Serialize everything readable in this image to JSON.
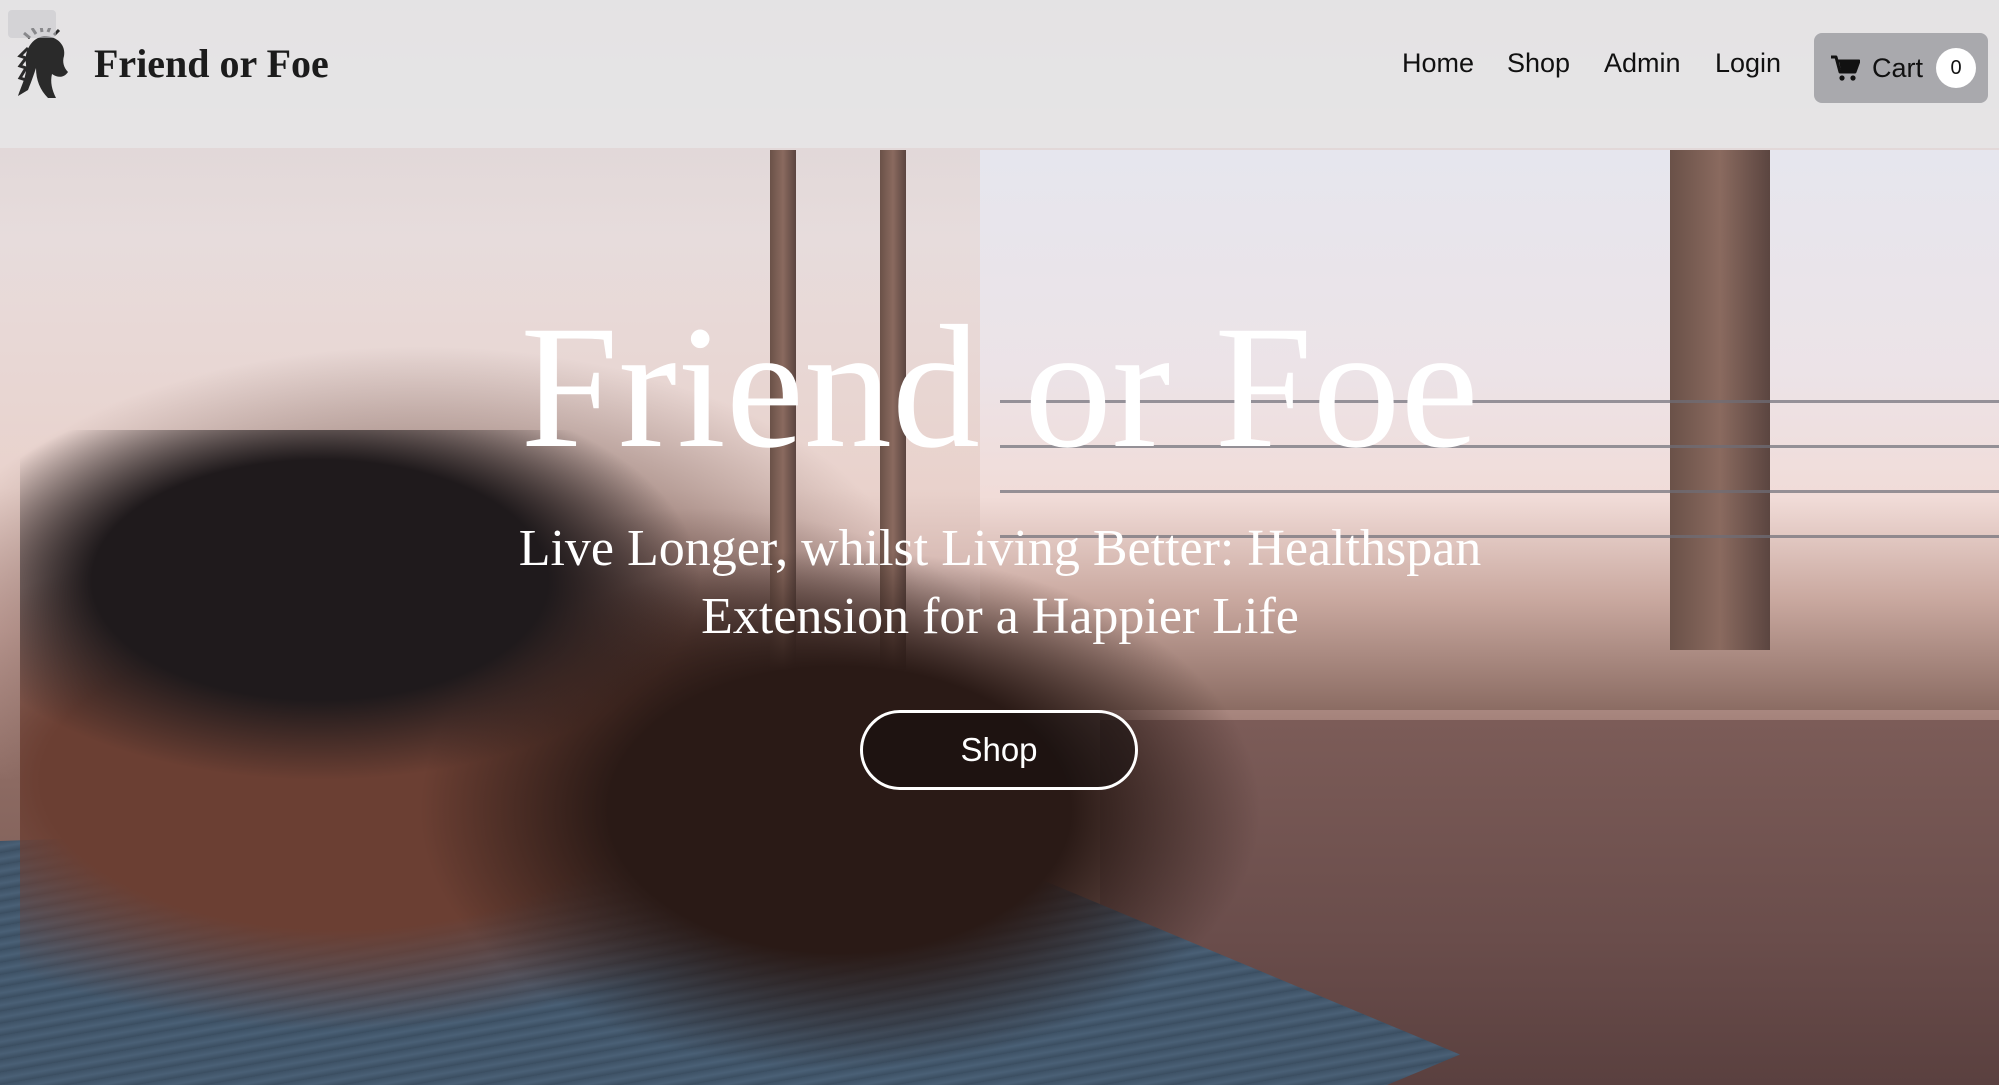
{
  "header": {
    "brand": "Friend or Foe",
    "nav": {
      "home": "Home",
      "shop": "Shop",
      "admin": "Admin",
      "login": "Login"
    },
    "cart": {
      "label": "Cart",
      "count": "0",
      "icon": "cart-icon"
    },
    "logo_icon": "native-headdress-logo"
  },
  "hero": {
    "title": "Friend or Foe",
    "subtitle": "Live Longer, whilst Living Better: Healthspan Extension for a Happier Life",
    "button_label": "Shop"
  },
  "colors": {
    "header_bg": "#e6e6e8",
    "cart_bg": "#a9a9ad",
    "hero_text": "#ffffff"
  }
}
